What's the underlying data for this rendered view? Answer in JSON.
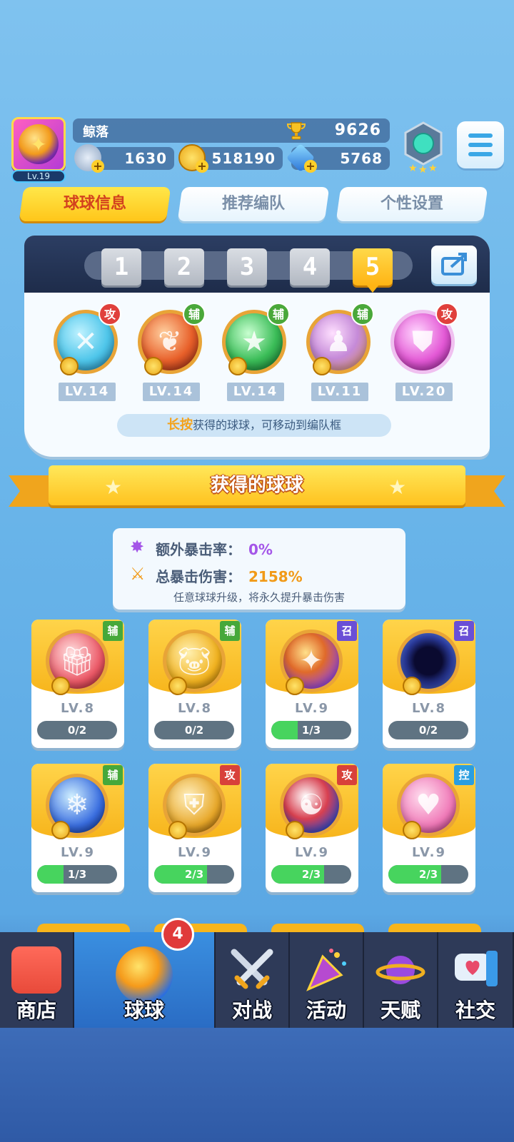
{
  "player": {
    "name": "鲸落",
    "level": "Lv.19",
    "trophies": "9626",
    "resources": {
      "stamina": "1630",
      "gold": "518190",
      "gems": "5768"
    }
  },
  "tabs": [
    "球球信息",
    "推荐编队",
    "个性设置"
  ],
  "team": {
    "slots": [
      "1",
      "2",
      "3",
      "4",
      "5"
    ],
    "active_slot": 5,
    "balls": [
      {
        "tag": "攻",
        "level": "LV.14",
        "color": "#4fc6ea"
      },
      {
        "tag": "辅",
        "level": "LV.14",
        "color": "#e8602a"
      },
      {
        "tag": "辅",
        "level": "LV.14",
        "color": "#3bbd58"
      },
      {
        "tag": "辅",
        "level": "LV.11",
        "color": "#c58ad8"
      },
      {
        "tag": "攻",
        "level": "LV.20",
        "color": "#e45ad6"
      }
    ],
    "hint_highlight": "长按",
    "hint_text": "获得的球球，可移动到编队框"
  },
  "section_title": "获得的球球",
  "crit": {
    "extra_label": "额外暴击率：",
    "extra_value": "0%",
    "total_label": "总暴击伤害：",
    "total_value": "2158%",
    "note": "任意球球升级，将永久提升暴击伤害"
  },
  "collection": [
    {
      "tag": "辅",
      "tag_type": "sup",
      "level": "LV.8",
      "progress": "0/2",
      "fill": 0,
      "color": "#ec5a68"
    },
    {
      "tag": "辅",
      "tag_type": "sup",
      "level": "LV.8",
      "progress": "0/2",
      "fill": 0,
      "color": "#f2b320"
    },
    {
      "tag": "召",
      "tag_type": "sum",
      "level": "LV.9",
      "progress": "1/3",
      "fill": 0.33,
      "color": "#9b4ad0"
    },
    {
      "tag": "召",
      "tag_type": "sum",
      "level": "LV.8",
      "progress": "0/2",
      "fill": 0,
      "color": "#2a3a9a"
    },
    {
      "tag": "辅",
      "tag_type": "sup",
      "level": "LV.9",
      "progress": "1/3",
      "fill": 0.33,
      "color": "#3a6ee0"
    },
    {
      "tag": "攻",
      "tag_type": "atk",
      "level": "LV.9",
      "progress": "2/3",
      "fill": 0.66,
      "color": "#e8a82a"
    },
    {
      "tag": "攻",
      "tag_type": "atk",
      "level": "LV.9",
      "progress": "2/3",
      "fill": 0.66,
      "color": "#d84050"
    },
    {
      "tag": "控",
      "tag_type": "ctl",
      "level": "LV.9",
      "progress": "2/3",
      "fill": 0.66,
      "color": "#f07ab8"
    }
  ],
  "nav": {
    "items": [
      "商店",
      "球球",
      "对战",
      "活动",
      "天赋",
      "社交"
    ],
    "active": "球球",
    "badge": "4"
  }
}
